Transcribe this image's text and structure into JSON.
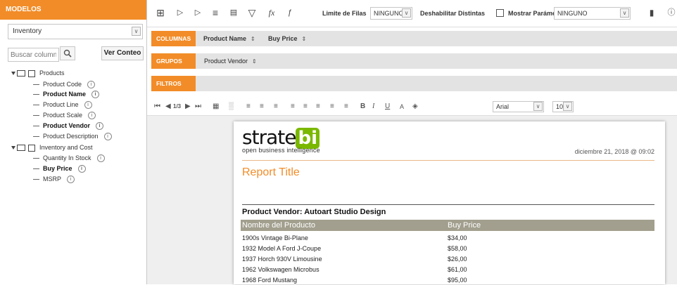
{
  "left_panel": {
    "header": "MODELOS",
    "model_select": "Inventory",
    "search_placeholder": "Buscar columnas",
    "ver_button": "Ver Conteo",
    "tree": [
      {
        "type": "folder",
        "label": "Products"
      },
      {
        "type": "item",
        "label": "Product Code",
        "bold": false
      },
      {
        "type": "item",
        "label": "Product Name",
        "bold": true
      },
      {
        "type": "item",
        "label": "Product Line",
        "bold": false
      },
      {
        "type": "item",
        "label": "Product Scale",
        "bold": false
      },
      {
        "type": "item",
        "label": "Product Vendor",
        "bold": true
      },
      {
        "type": "item",
        "label": "Product Description",
        "bold": false
      },
      {
        "type": "folder",
        "label": "Inventory and Cost"
      },
      {
        "type": "item",
        "label": "Quantity In Stock",
        "bold": false
      },
      {
        "type": "item",
        "label": "Buy Price",
        "bold": true
      },
      {
        "type": "item",
        "label": "MSRP",
        "bold": false
      }
    ]
  },
  "toolbar": {
    "limit_label": "Limite de Filas",
    "limit_value": "NINGUNO",
    "distinct_label": "Deshabilitar Distintas",
    "params_label": "Mostrar Parámetros",
    "params_value": "NINGUNO"
  },
  "sections": {
    "columnas": {
      "label": "COLUMNAS",
      "pills": [
        "Product Name",
        "Buy Price"
      ]
    },
    "grupos": {
      "label": "GRUPOS",
      "pills": [
        "Product Vendor"
      ]
    },
    "filtros": {
      "label": "FILTROS"
    }
  },
  "format_bar": {
    "page": "1/3",
    "font": "Arial",
    "size": "10"
  },
  "report": {
    "logo_main": "strate",
    "logo_bi": "bi",
    "logo_sub": "open business intelligence",
    "date": "diciembre 21, 2018 @ 09:02",
    "title": "Report Title",
    "group_header": "Product Vendor: Autoart Studio Design",
    "columns": [
      "Nombre del Producto",
      "Buy Price"
    ],
    "rows": [
      [
        "1900s Vintage Bi-Plane",
        "$34,00"
      ],
      [
        "1932 Model A Ford J-Coupe",
        "$58,00"
      ],
      [
        "1937 Horch 930V Limousine",
        "$26,00"
      ],
      [
        "1962 Volkswagen Microbus",
        "$61,00"
      ],
      [
        "1968 Ford Mustang",
        "$95,00"
      ]
    ]
  },
  "colors": {
    "accent": "#f28c28",
    "table_header": "#a29f8e",
    "logo_green": "#7ab800"
  }
}
